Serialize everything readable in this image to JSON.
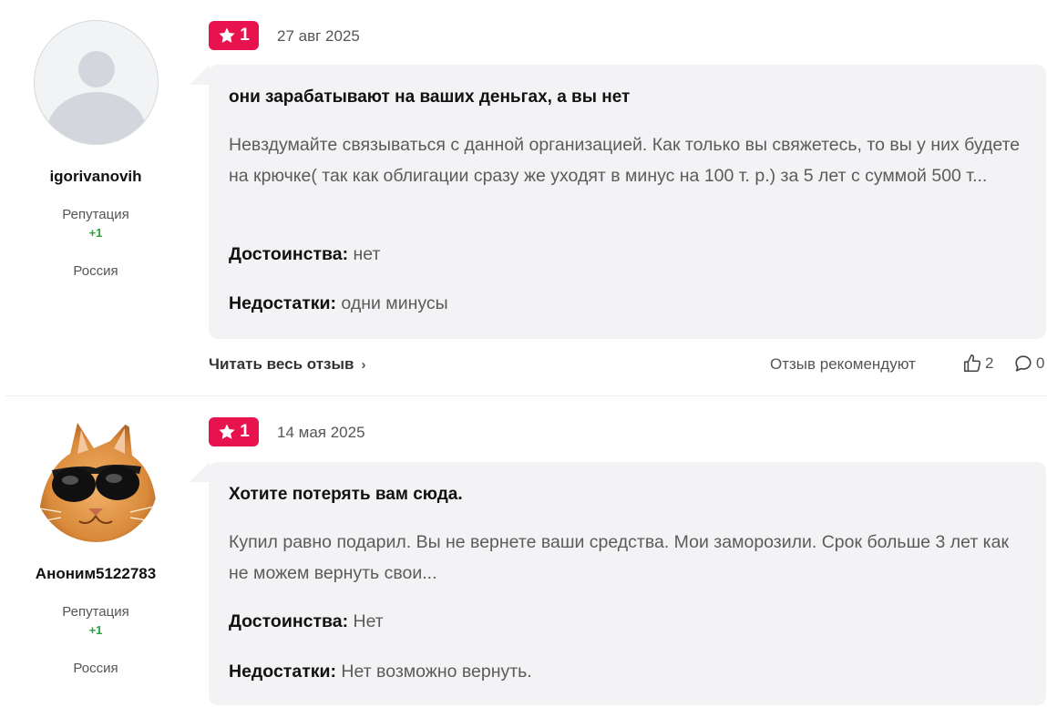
{
  "reviews": [
    {
      "author": "igorivanovih",
      "avatar": "default-user-avatar",
      "reputation_label": "Репутация",
      "reputation_value": "+1",
      "country": "Россия",
      "rating": "1",
      "date": "27 авг 2025",
      "title": "они зарабатывают на ваших деньгах, а вы нет",
      "text": "Невздумайте связываться с данной организацией. Как только вы свяжетесь, то вы у них будете на крючке( так как облигации сразу же уходят в минус на 100 т. р.) за 5 лет с суммой 500 т...",
      "pros_label": "Достоинства:",
      "pros": "нет",
      "cons_label": "Недостатки:",
      "cons": "одни минусы",
      "read_more": "Читать весь отзыв",
      "recommend_label": "Отзыв рекомендуют",
      "likes": "2",
      "comments": "0"
    },
    {
      "author": "Аноним5122783",
      "avatar": "cat-with-sunglasses-avatar",
      "reputation_label": "Репутация",
      "reputation_value": "+1",
      "country": "Россия",
      "rating": "1",
      "date": "14 мая 2025",
      "title": "Хотите потерять вам сюда.",
      "text": "Купил равно подарил. Вы не вернете ваши средства. Мои заморозили. Срок больше 3 лет как не можем вернуть свои...",
      "pros_label": "Достоинства:",
      "pros": "Нет",
      "cons_label": "Недостатки:",
      "cons": "Нет возможно вернуть."
    }
  ],
  "colors": {
    "rating_badge": "#e8124f",
    "bubble_bg": "#f3f3f5",
    "reputation_positive": "#2aa33a"
  },
  "icons": {
    "rating": "star-icon",
    "read_more": "chevron-right-icon",
    "likes": "thumbs-up-icon",
    "comments": "comment-bubble-icon"
  }
}
